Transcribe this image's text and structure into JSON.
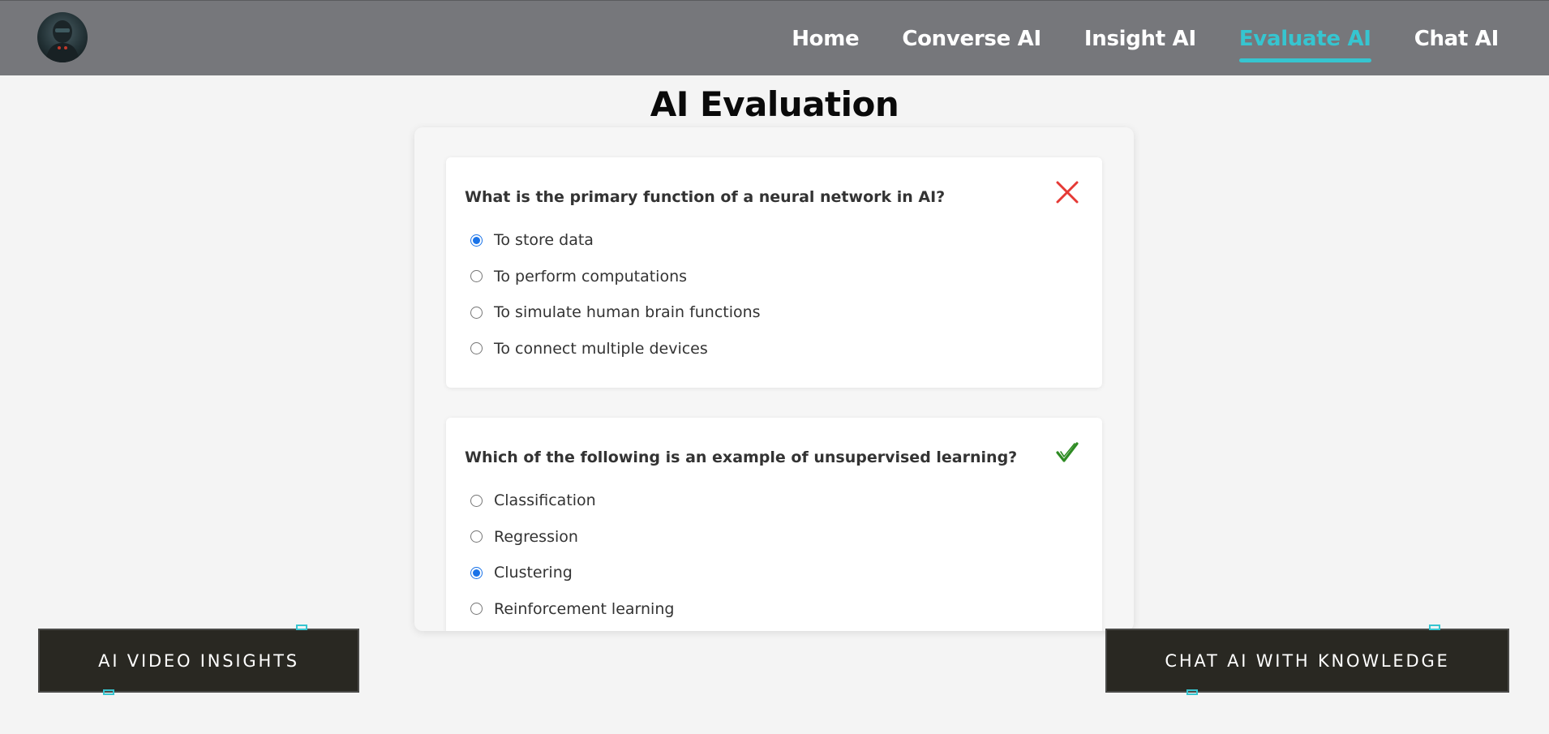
{
  "nav": {
    "avatar_icon": "robot-avatar-icon",
    "links": [
      {
        "label": "Home",
        "active": false
      },
      {
        "label": "Converse AI",
        "active": false
      },
      {
        "label": "Insight AI",
        "active": false
      },
      {
        "label": "Evaluate AI",
        "active": true
      },
      {
        "label": "Chat AI",
        "active": false
      }
    ],
    "active_color": "#36c5d0"
  },
  "page_title": "AI Evaluation",
  "questions": [
    {
      "text": "What is the primary function of a neural network in AI?",
      "options": [
        "To store data",
        "To perform computations",
        "To simulate human brain functions",
        "To connect multiple devices"
      ],
      "selected_index": 0,
      "result": "incorrect",
      "result_icon": "cross-icon",
      "result_color": "#e53935"
    },
    {
      "text": "Which of the following is an example of unsupervised learning?",
      "options": [
        "Classification",
        "Regression",
        "Clustering",
        "Reinforcement learning"
      ],
      "selected_index": 2,
      "result": "correct",
      "result_icon": "checkmark-icon",
      "result_color": "#2e8b23"
    }
  ],
  "buttons": {
    "left_label": "AI VIDEO INSIGHTS",
    "right_label": "CHAT AI WITH KNOWLEDGE"
  }
}
